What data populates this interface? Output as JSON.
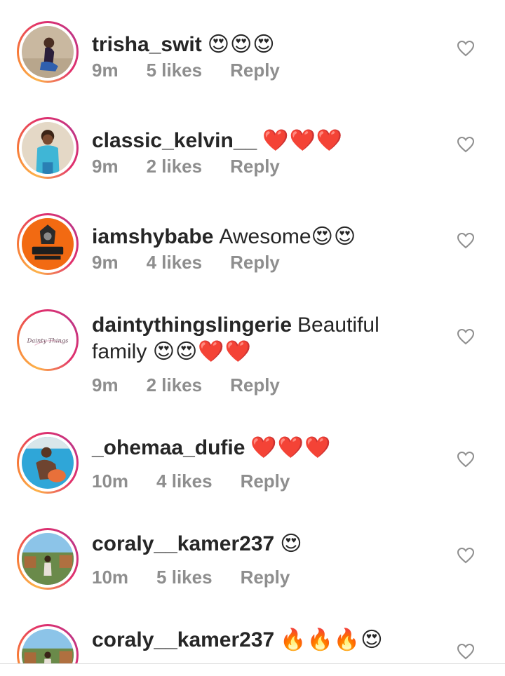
{
  "comments": [
    {
      "username": "trisha_swit",
      "text": "",
      "emojis": "😍😍😍",
      "time": "9m",
      "likes": "5 likes",
      "reply": "Reply"
    },
    {
      "username": "classic_kelvin__",
      "text": "",
      "emojis": "❤️❤️❤️",
      "time": "9m",
      "likes": "2 likes",
      "reply": "Reply"
    },
    {
      "username": "iamshybabe",
      "text": "Awesome",
      "emojis": "😍😍",
      "time": "9m",
      "likes": "4 likes",
      "reply": "Reply"
    },
    {
      "username": "daintythingslingerie",
      "text": "Beautiful family",
      "emojis": "😍😍❤️❤️",
      "time": "9m",
      "likes": "2 likes",
      "reply": "Reply"
    },
    {
      "username": "_ohemaa_dufie",
      "text": "",
      "emojis": "❤️❤️❤️",
      "time": "10m",
      "likes": "4 likes",
      "reply": "Reply"
    },
    {
      "username": "coraly__kamer237",
      "text": "",
      "emojis": "😍",
      "time": "10m",
      "likes": "5 likes",
      "reply": "Reply"
    },
    {
      "username": "coraly__kamer237",
      "text": "",
      "emojis": "🔥🔥🔥😍",
      "time": "",
      "likes": "",
      "reply": ""
    }
  ],
  "avatar_logo_text": "Dainty Things",
  "icons": {
    "like": "heart-outline-icon"
  },
  "colors": {
    "text": "#262626",
    "meta": "#8e8e8e",
    "ring_start": "#fdb24a",
    "ring_end": "#e1306c"
  }
}
